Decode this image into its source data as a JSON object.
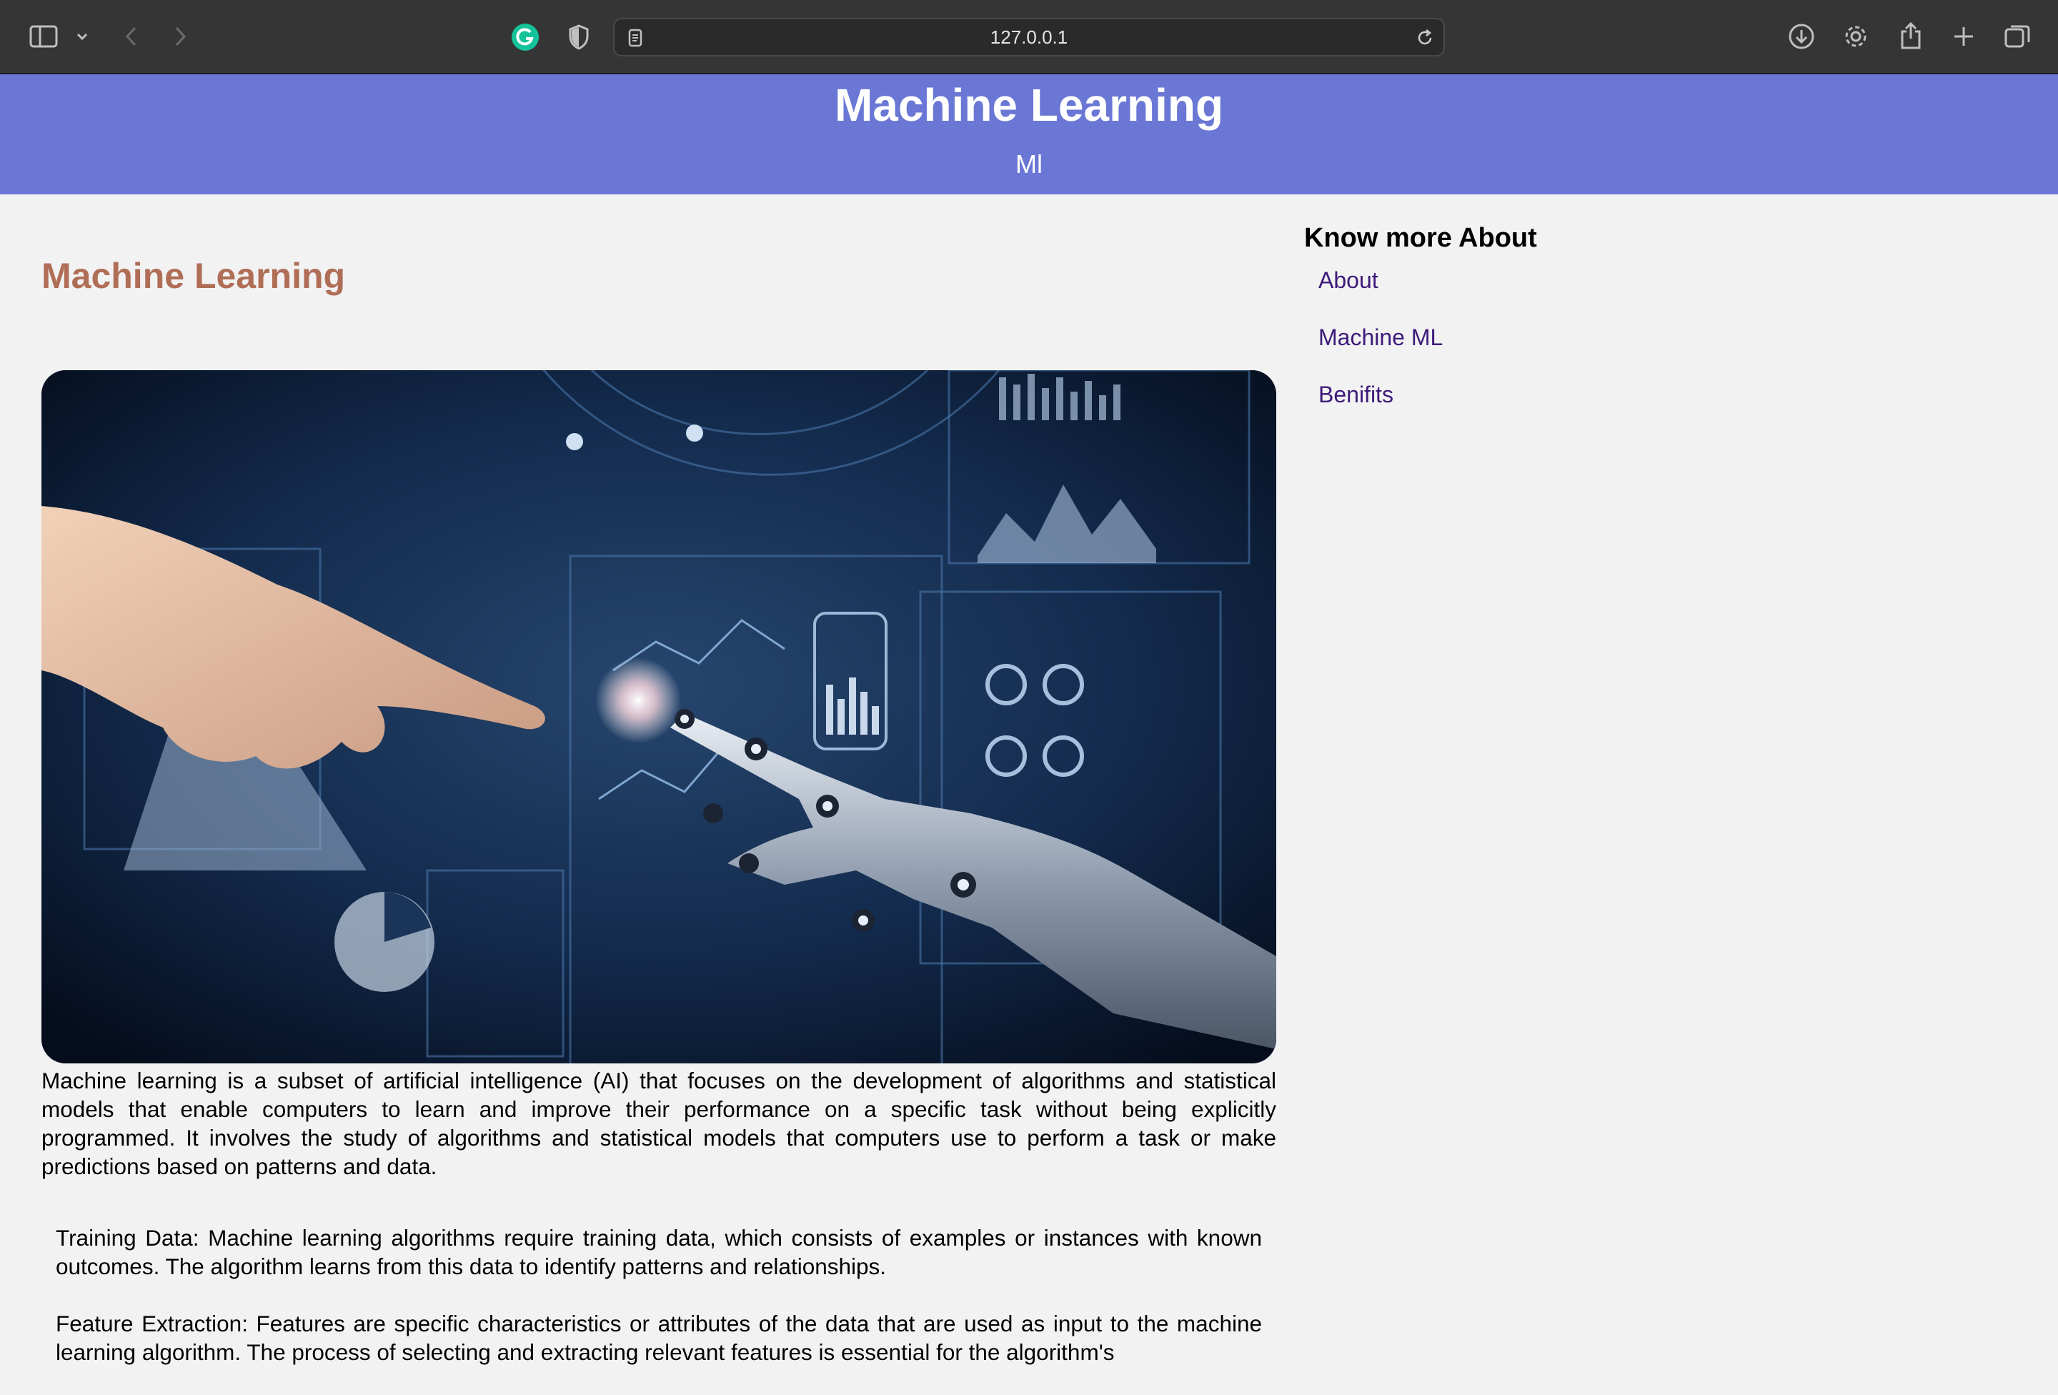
{
  "browser": {
    "url": "127.0.0.1"
  },
  "header": {
    "title": "Machine Learning",
    "subtitle": "Ml"
  },
  "article": {
    "title": "Machine Learning",
    "image_alt": "robot hand and human hand reaching toward a data dashboard",
    "lead": "Machine learning is a subset of artificial intelligence (AI) that focuses on the development of algorithms and statistical models that enable computers to learn and improve their performance on a specific task without being explicitly programmed. It involves the study of algorithms and statistical models that computers use to perform a task or make predictions based on patterns and data.",
    "points": [
      "Training Data: Machine learning algorithms require training data, which consists of examples or instances with known outcomes. The algorithm learns from this data to identify patterns and relationships.",
      "Feature Extraction: Features are specific characteristics or attributes of the data that are used as input to the machine learning algorithm. The process of selecting and extracting relevant features is essential for the algorithm's"
    ]
  },
  "sidebar": {
    "title": "Know more About",
    "links": [
      {
        "label": "About"
      },
      {
        "label": "Machine ML"
      },
      {
        "label": "Benifits"
      }
    ]
  },
  "colors": {
    "header_bg": "#6a77d5",
    "article_title": "#b06e57",
    "link": "#3d1a7a",
    "page_bg": "#f2f2f2"
  }
}
